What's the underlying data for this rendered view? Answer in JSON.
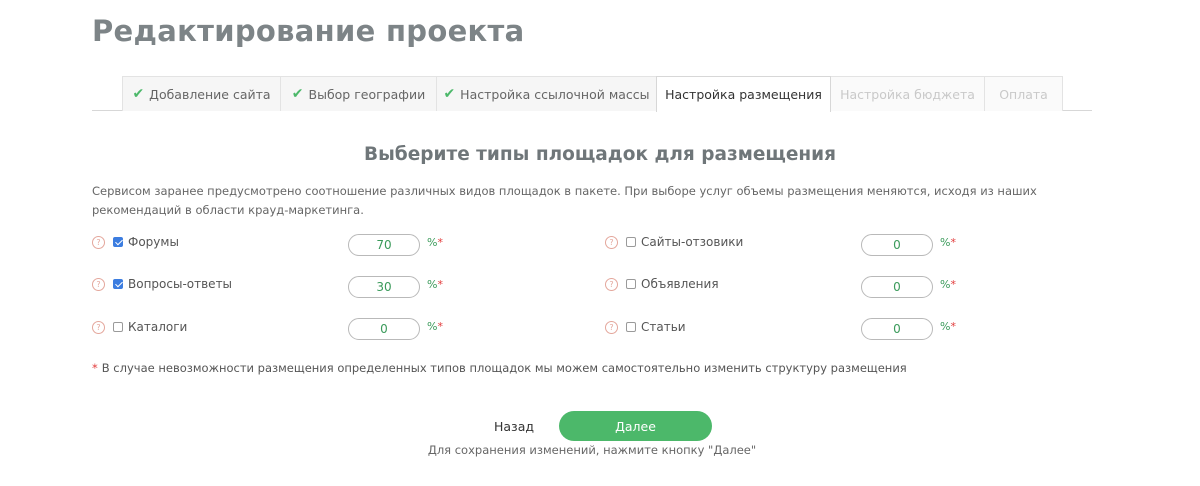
{
  "page_title": "Редактирование проекта",
  "tabs": [
    {
      "label": "Добавление сайта",
      "state": "done"
    },
    {
      "label": "Выбор географии",
      "state": "done"
    },
    {
      "label": "Настройка ссылочной массы",
      "state": "done"
    },
    {
      "label": "Настройка размещения",
      "state": "active"
    },
    {
      "label": "Настройка бюджета",
      "state": "disabled"
    },
    {
      "label": "Оплата",
      "state": "disabled"
    }
  ],
  "icons": {
    "tab_check": "check-icon",
    "help": "question-circle-icon"
  },
  "section_title": "Выберите типы площадок для размещения",
  "description": "Сервисом заранее предусмотрено соотношение различных видов площадок в пакете. При выборе услуг объемы размещения меняются, исходя из наших рекомендаций в области крауд-маркетинга.",
  "help_symbol": "?",
  "platforms": [
    {
      "label": "Форумы",
      "checked": true,
      "value": "70",
      "unit": "%",
      "required_mark": "*"
    },
    {
      "label": "Вопросы-ответы",
      "checked": true,
      "value": "30",
      "unit": "%",
      "required_mark": "*"
    },
    {
      "label": "Каталоги",
      "checked": false,
      "value": "0",
      "unit": "%",
      "required_mark": "*"
    },
    {
      "label": "Сайты-отзовики",
      "checked": false,
      "value": "0",
      "unit": "%",
      "required_mark": "*"
    },
    {
      "label": "Объявления",
      "checked": false,
      "value": "0",
      "unit": "%",
      "required_mark": "*"
    },
    {
      "label": "Статьи",
      "checked": false,
      "value": "0",
      "unit": "%",
      "required_mark": "*"
    }
  ],
  "footnote": {
    "star": "*",
    "text": "В случае невозможности размещения определенных типов площадок мы можем самостоятельно изменить структуру размещения"
  },
  "buttons": {
    "back": "Назад",
    "next": "Далее"
  },
  "hint": "Для сохранения изменений, нажмите кнопку \"Далее\"",
  "colors": {
    "accent": "#4cb86a",
    "checkbox": "#3c7de0",
    "required": "#e23b3b",
    "title": "#7d8487"
  }
}
